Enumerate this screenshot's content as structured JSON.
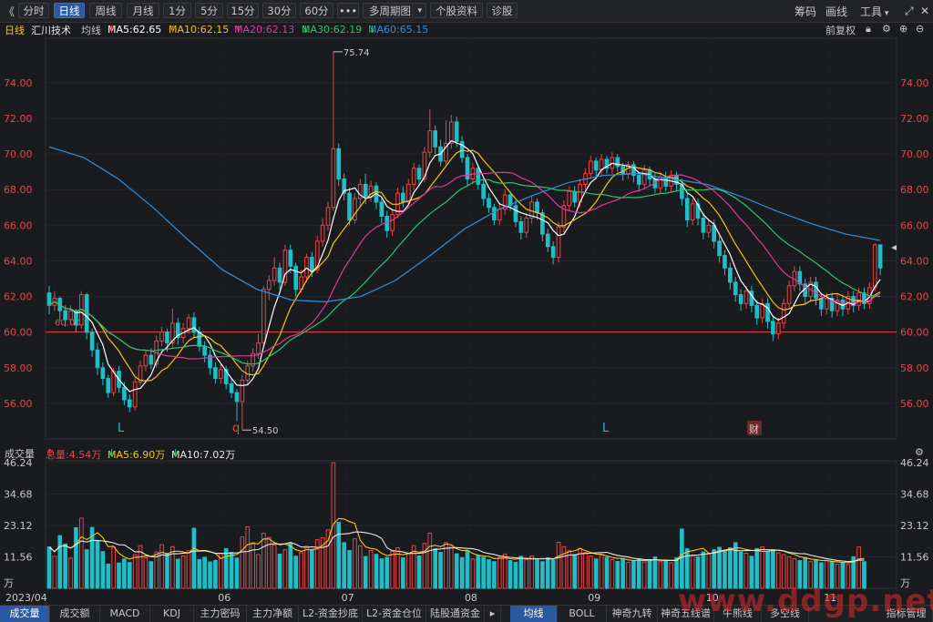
{
  "toolbar": {
    "collapse": "《",
    "periods": [
      "分时",
      "日线",
      "周线",
      "月线",
      "1分",
      "5分",
      "15分",
      "30分",
      "60分"
    ],
    "active_period": "日线",
    "more": "•••",
    "multi_period": "多周期图",
    "stock_info": "个股资料",
    "diagnose": "诊股",
    "chips": "筹码",
    "draw": "画线",
    "tools": "工具"
  },
  "ma_legend": {
    "period": "日线",
    "stock_name": "汇川技术",
    "line_type": "均线",
    "ma5": "MA5:62.65",
    "ma10": "MA10:62.15",
    "ma20": "MA20:62.13",
    "ma30": "MA30:62.19",
    "ma60": "MA60:65.15",
    "adjust": "前复权",
    "colors": {
      "ma5": "#ffffff",
      "ma10": "#f5c518",
      "ma20": "#e0389a",
      "ma30": "#2ec46a",
      "ma60": "#2f8fe0"
    }
  },
  "vol_legend": {
    "title": "成交量",
    "total": "总量:4.54万",
    "ma5": "MA5:6.90万",
    "ma10": "MA10:7.02万"
  },
  "chart_data": {
    "type": "candlestick",
    "price_axis_ticks": [
      "74.00",
      "72.00",
      "70.00",
      "68.00",
      "66.00",
      "64.00",
      "62.00",
      "60.00",
      "58.00",
      "56.00"
    ],
    "price_ylim": [
      54.0,
      76.5
    ],
    "x_labels": [
      "2023/04",
      "06",
      "07",
      "08",
      "09",
      "10",
      "11"
    ],
    "annotations": {
      "high": "75.74",
      "low": "54.50",
      "ref_line": "60.00",
      "markers": [
        "L",
        "q",
        "L",
        "财"
      ]
    },
    "volume_axis_ticks": [
      "46.24",
      "34.68",
      "23.12",
      "11.56",
      "万"
    ],
    "volume_unit": "万",
    "colors": {
      "up": "#e84545",
      "down": "#1fbfc9",
      "bg": "#1a1b1f",
      "grid": "#2a2b30",
      "axis_text": "#e84545"
    },
    "candles": [
      [
        62.2,
        61.5,
        62.6,
        61.0
      ],
      [
        61.5,
        61.9,
        62.3,
        61.2
      ],
      [
        61.9,
        61.2,
        62.0,
        60.6
      ],
      [
        61.2,
        60.7,
        61.5,
        60.3
      ],
      [
        60.7,
        61.2,
        61.5,
        60.4
      ],
      [
        61.2,
        60.4,
        61.3,
        60.0
      ],
      [
        60.4,
        62.1,
        62.3,
        60.2
      ],
      [
        62.1,
        60.0,
        62.2,
        59.6
      ],
      [
        60.0,
        59.0,
        60.2,
        58.6
      ],
      [
        59.0,
        58.0,
        59.4,
        57.6
      ],
      [
        58.0,
        57.4,
        58.3,
        57.0
      ],
      [
        57.4,
        56.6,
        57.6,
        56.3
      ],
      [
        56.6,
        57.8,
        58.0,
        56.4
      ],
      [
        57.8,
        56.9,
        58.1,
        56.6
      ],
      [
        56.9,
        56.2,
        57.2,
        55.9
      ],
      [
        56.2,
        55.8,
        56.5,
        55.5
      ],
      [
        55.8,
        57.2,
        57.4,
        55.6
      ],
      [
        57.2,
        58.1,
        58.4,
        57.0
      ],
      [
        58.1,
        58.7,
        59.0,
        57.8
      ],
      [
        58.7,
        58.2,
        59.1,
        57.9
      ],
      [
        58.2,
        59.5,
        59.8,
        58.0
      ],
      [
        59.5,
        60.0,
        60.3,
        59.2
      ],
      [
        60.0,
        59.4,
        60.2,
        58.9
      ],
      [
        59.4,
        60.5,
        61.3,
        59.1
      ],
      [
        60.5,
        59.7,
        60.8,
        59.3
      ],
      [
        59.7,
        60.2,
        60.5,
        59.4
      ],
      [
        60.2,
        60.8,
        61.0,
        59.9
      ],
      [
        60.8,
        60.0,
        61.1,
        59.7
      ],
      [
        60.0,
        59.2,
        60.3,
        58.9
      ],
      [
        59.2,
        58.7,
        59.5,
        58.3
      ],
      [
        58.7,
        58.0,
        59.0,
        57.6
      ],
      [
        58.0,
        57.4,
        58.3,
        57.1
      ],
      [
        57.4,
        57.9,
        58.2,
        57.1
      ],
      [
        57.9,
        57.1,
        58.1,
        56.8
      ],
      [
        57.1,
        56.6,
        57.4,
        56.3
      ],
      [
        56.6,
        56.1,
        56.8,
        55.0
      ],
      [
        56.1,
        57.3,
        57.6,
        54.5
      ],
      [
        57.3,
        58.1,
        58.4,
        57.0
      ],
      [
        58.1,
        58.8,
        59.1,
        57.8
      ],
      [
        58.8,
        59.4,
        59.9,
        58.5
      ],
      [
        59.4,
        62.4,
        62.6,
        59.2
      ],
      [
        62.4,
        62.9,
        63.2,
        61.8
      ],
      [
        62.9,
        63.6,
        64.2,
        62.6
      ],
      [
        63.6,
        62.8,
        63.9,
        62.4
      ],
      [
        62.8,
        64.6,
        64.9,
        62.6
      ],
      [
        64.6,
        63.7,
        64.9,
        63.3
      ],
      [
        63.7,
        62.4,
        63.9,
        62.0
      ],
      [
        62.4,
        63.1,
        63.5,
        62.2
      ],
      [
        63.1,
        64.2,
        64.4,
        62.8
      ],
      [
        64.2,
        63.5,
        64.5,
        63.1
      ],
      [
        63.5,
        65.1,
        65.4,
        63.3
      ],
      [
        65.1,
        66.0,
        66.4,
        64.8
      ],
      [
        66.0,
        67.0,
        67.3,
        65.7
      ],
      [
        67.0,
        70.3,
        75.74,
        66.8
      ],
      [
        70.3,
        68.6,
        70.6,
        68.2
      ],
      [
        68.6,
        67.8,
        68.9,
        67.4
      ],
      [
        67.8,
        66.3,
        68.1,
        66.0
      ],
      [
        66.3,
        67.5,
        67.8,
        66.1
      ],
      [
        67.5,
        68.3,
        68.6,
        67.1
      ],
      [
        68.3,
        67.6,
        68.9,
        67.2
      ],
      [
        67.6,
        68.2,
        68.5,
        67.3
      ],
      [
        68.2,
        67.3,
        68.4,
        66.9
      ],
      [
        67.3,
        66.5,
        67.6,
        66.1
      ],
      [
        66.5,
        65.7,
        66.8,
        65.3
      ],
      [
        65.7,
        66.6,
        66.9,
        65.4
      ],
      [
        66.6,
        67.8,
        68.1,
        66.4
      ],
      [
        67.8,
        67.3,
        68.2,
        67.0
      ],
      [
        67.3,
        68.3,
        68.6,
        67.1
      ],
      [
        68.3,
        69.2,
        69.5,
        68.0
      ],
      [
        69.2,
        68.6,
        69.4,
        68.2
      ],
      [
        68.6,
        70.1,
        70.4,
        68.4
      ],
      [
        70.1,
        71.3,
        72.5,
        69.8
      ],
      [
        71.3,
        70.4,
        71.6,
        70.0
      ],
      [
        70.4,
        69.6,
        70.8,
        69.3
      ],
      [
        69.6,
        70.6,
        71.9,
        69.4
      ],
      [
        70.6,
        71.8,
        72.2,
        70.3
      ],
      [
        71.8,
        70.7,
        72.1,
        70.4
      ],
      [
        70.7,
        69.8,
        71.0,
        69.5
      ],
      [
        69.8,
        68.6,
        70.0,
        68.2
      ],
      [
        68.6,
        69.2,
        69.5,
        68.3
      ],
      [
        69.2,
        68.3,
        69.4,
        68.0
      ],
      [
        68.3,
        67.5,
        68.6,
        67.1
      ],
      [
        67.5,
        67.0,
        67.8,
        66.7
      ],
      [
        67.0,
        66.3,
        67.2,
        66.0
      ],
      [
        66.3,
        66.9,
        67.2,
        66.0
      ],
      [
        66.9,
        67.7,
        68.0,
        66.6
      ],
      [
        67.7,
        67.1,
        67.9,
        66.8
      ],
      [
        67.1,
        66.2,
        67.4,
        65.9
      ],
      [
        66.2,
        65.6,
        66.5,
        65.2
      ],
      [
        65.6,
        66.4,
        66.7,
        65.3
      ],
      [
        66.4,
        67.3,
        67.6,
        66.1
      ],
      [
        67.3,
        66.7,
        67.5,
        66.3
      ],
      [
        66.7,
        65.5,
        66.9,
        65.1
      ],
      [
        65.5,
        64.8,
        65.8,
        64.5
      ],
      [
        64.8,
        64.2,
        65.1,
        63.8
      ],
      [
        64.2,
        65.9,
        66.2,
        63.9
      ],
      [
        65.9,
        67.1,
        67.4,
        65.6
      ],
      [
        67.1,
        67.9,
        68.2,
        66.8
      ],
      [
        67.9,
        67.3,
        68.2,
        67.0
      ],
      [
        67.3,
        68.3,
        68.6,
        67.0
      ],
      [
        68.3,
        68.9,
        69.2,
        68.0
      ],
      [
        68.9,
        69.6,
        69.9,
        68.6
      ],
      [
        69.6,
        69.1,
        69.8,
        68.7
      ],
      [
        69.1,
        69.7,
        70.0,
        68.8
      ],
      [
        69.7,
        69.2,
        69.9,
        68.9
      ],
      [
        69.2,
        69.8,
        70.1,
        68.9
      ],
      [
        69.8,
        69.3,
        70.0,
        69.0
      ],
      [
        69.3,
        68.9,
        69.5,
        68.5
      ],
      [
        68.9,
        69.4,
        69.6,
        68.6
      ],
      [
        69.4,
        68.8,
        69.6,
        68.4
      ],
      [
        68.8,
        68.3,
        69.0,
        67.9
      ],
      [
        68.3,
        69.1,
        69.4,
        68.0
      ],
      [
        69.1,
        68.6,
        69.3,
        68.2
      ],
      [
        68.6,
        68.1,
        68.9,
        67.8
      ],
      [
        68.1,
        68.7,
        69.0,
        67.8
      ],
      [
        68.7,
        68.2,
        69.0,
        67.9
      ],
      [
        68.2,
        68.8,
        69.1,
        67.9
      ],
      [
        68.8,
        68.3,
        69.0,
        67.9
      ],
      [
        68.3,
        67.5,
        68.6,
        67.1
      ],
      [
        67.5,
        66.3,
        67.8,
        65.9
      ],
      [
        66.3,
        67.2,
        67.5,
        66.0
      ],
      [
        67.2,
        66.4,
        67.5,
        66.0
      ],
      [
        66.4,
        65.6,
        66.7,
        65.2
      ],
      [
        65.6,
        66.0,
        66.3,
        65.3
      ],
      [
        66.0,
        65.1,
        66.3,
        64.7
      ],
      [
        65.1,
        64.3,
        65.4,
        63.9
      ],
      [
        64.3,
        63.6,
        64.6,
        63.2
      ],
      [
        63.6,
        62.8,
        63.9,
        62.4
      ],
      [
        62.8,
        62.1,
        63.1,
        61.7
      ],
      [
        62.1,
        61.6,
        62.4,
        61.2
      ],
      [
        61.6,
        62.3,
        62.6,
        61.3
      ],
      [
        62.3,
        61.5,
        62.6,
        61.1
      ],
      [
        61.5,
        60.8,
        61.8,
        60.4
      ],
      [
        60.8,
        61.6,
        61.9,
        60.5
      ],
      [
        61.6,
        60.6,
        61.9,
        60.2
      ],
      [
        60.6,
        59.9,
        60.9,
        59.5
      ],
      [
        59.9,
        60.5,
        60.8,
        59.6
      ],
      [
        60.5,
        61.6,
        61.9,
        60.2
      ],
      [
        61.6,
        62.6,
        62.9,
        61.3
      ],
      [
        62.6,
        63.4,
        63.7,
        62.3
      ],
      [
        63.4,
        62.7,
        63.7,
        62.3
      ],
      [
        62.7,
        62.0,
        63.0,
        61.6
      ],
      [
        62.0,
        62.8,
        63.1,
        61.7
      ],
      [
        62.8,
        61.9,
        63.1,
        61.5
      ],
      [
        61.9,
        61.3,
        62.2,
        60.9
      ],
      [
        61.3,
        61.9,
        62.2,
        61.0
      ],
      [
        61.9,
        61.2,
        62.2,
        60.8
      ],
      [
        61.2,
        61.8,
        62.1,
        60.9
      ],
      [
        61.8,
        61.3,
        62.1,
        60.9
      ],
      [
        61.3,
        62.0,
        62.3,
        61.0
      ],
      [
        62.0,
        61.5,
        62.3,
        61.1
      ],
      [
        61.5,
        62.2,
        62.5,
        61.2
      ],
      [
        62.2,
        61.6,
        62.5,
        61.3
      ],
      [
        61.6,
        62.5,
        62.8,
        61.3
      ],
      [
        62.5,
        64.9,
        65.0,
        62.3
      ],
      [
        64.9,
        63.6,
        64.9,
        63.2
      ]
    ],
    "volumes": [
      15.2,
      11.8,
      19.4,
      16.3,
      11.1,
      22.3,
      25.8,
      14.2,
      22.4,
      17.6,
      13.5,
      8.9,
      15.1,
      9.3,
      10.8,
      9.5,
      12.4,
      15.7,
      11.2,
      9.8,
      13.4,
      16.1,
      12.9,
      15.3,
      10.7,
      11.9,
      13.8,
      22.1,
      10.6,
      11.4,
      9.7,
      10.3,
      12.8,
      14.6,
      13.2,
      11.1,
      18.9,
      22.6,
      16.8,
      12.4,
      20.3,
      18.7,
      15.9,
      12.6,
      14.2,
      16.4,
      11.8,
      13.1,
      15.5,
      14.2,
      17.9,
      18.6,
      21.5,
      46.24,
      24.3,
      16.8,
      13.9,
      18.2,
      15.6,
      11.7,
      13.9,
      12.5,
      10.8,
      11.4,
      13.6,
      14.9,
      11.2,
      12.8,
      15.7,
      11.9,
      16.5,
      20.3,
      14.6,
      13.2,
      16.8,
      15.4,
      12.7,
      11.3,
      13.9,
      10.8,
      12.1,
      11.4,
      10.5,
      9.8,
      11.3,
      12.6,
      10.2,
      9.6,
      11.8,
      10.5,
      11.9,
      10.7,
      9.8,
      11.2,
      10.4,
      16.9,
      15.3,
      13.8,
      12.4,
      14.7,
      13.1,
      11.9,
      10.8,
      12.2,
      11.4,
      10.6,
      9.9,
      10.8,
      9.5,
      10.2,
      10.9,
      9.7,
      10.4,
      11.5,
      9.8,
      10.3,
      9.4,
      11.2,
      21.8,
      14.5,
      12.3,
      11.6,
      13.4,
      12.8,
      14.2,
      15.1,
      13.7,
      14.9,
      16.8,
      13.3,
      12.9,
      11.8,
      14.6,
      15.2,
      13.5,
      14.2,
      13.0,
      12.4,
      11.6,
      10.9,
      10.2,
      11.3,
      9.8,
      10.6,
      9.4,
      10.1,
      9.7,
      8.9,
      9.5,
      8.7,
      11.6,
      15.2,
      9.8
    ],
    "series": [
      {
        "name": "MA5",
        "color": "#ffffff"
      },
      {
        "name": "MA10",
        "color": "#f5c518"
      },
      {
        "name": "MA20",
        "color": "#e0389a"
      },
      {
        "name": "MA30",
        "color": "#2ec46a"
      },
      {
        "name": "MA60",
        "color": "#2f8fe0"
      }
    ],
    "ma60_anchor": [
      70.4,
      69.8,
      68.6,
      67.0,
      65.2,
      63.5,
      62.4,
      61.8,
      61.7,
      62.0,
      62.9,
      64.3,
      65.8,
      66.9,
      67.7,
      68.4,
      68.8,
      68.9,
      68.6,
      68.3,
      67.6,
      66.8,
      66.1,
      65.5,
      65.15
    ]
  },
  "bottom_tabs": {
    "left": [
      "成交量",
      "成交额",
      "MACD",
      "KDJ",
      "主力密码",
      "主力净额",
      "L2-资金抄底",
      "L2-资金仓位",
      "陆股通资金"
    ],
    "right": [
      "均线",
      "BOLL",
      "神奇九转",
      "神奇五线谱",
      "牛熊线",
      "多空线",
      "指标管理"
    ],
    "active_left": "成交量",
    "active_right": "均线"
  },
  "watermark": "www.ddgp.net"
}
